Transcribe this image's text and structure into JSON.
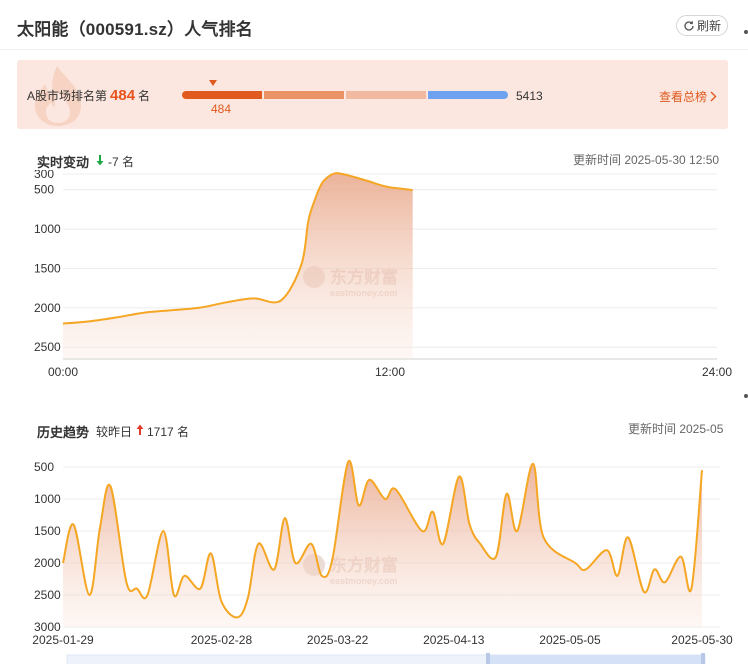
{
  "header": {
    "title": "太阳能（000591.sz）人气排名",
    "refresh_label": "刷新"
  },
  "rank": {
    "prefix": "A股市场排名第",
    "value": "484",
    "suffix": "名",
    "marker_label": "484",
    "total": "5413",
    "view_all": "查看总榜",
    "position_fraction": 0.0894
  },
  "realtime": {
    "title": "实时变动",
    "change_text": "-7 名",
    "update_time": "更新时间 2025-05-30 12:50"
  },
  "history": {
    "title": "历史趋势",
    "change_prefix": "较昨日",
    "change_text": "1717 名",
    "update_time": "更新时间 2025-05"
  },
  "watermark": {
    "cn": "东方财富",
    "en": "eastmoney.com"
  },
  "colors": {
    "line": "#f5a623",
    "accent": "#e0591e",
    "down": "#1ea844",
    "up": "#e03c2c"
  },
  "chart_data": [
    {
      "type": "area",
      "x_axis": "time",
      "xticks": [
        "00:00",
        "12:00",
        "24:00"
      ],
      "yticks": [
        300,
        500,
        1000,
        1500,
        2000,
        2500
      ],
      "ylim": [
        2650,
        300
      ],
      "y_inverted": true,
      "grid": true,
      "x": [
        "00:00",
        "01:00",
        "02:00",
        "03:00",
        "04:00",
        "05:00",
        "06:00",
        "07:00",
        "08:00",
        "08:45",
        "09:00",
        "09:15",
        "09:30",
        "09:45",
        "10:00",
        "10:15",
        "10:30",
        "10:45",
        "11:00",
        "11:15",
        "11:30",
        "11:45",
        "12:00",
        "12:30",
        "12:50"
      ],
      "values": [
        2200,
        2170,
        2120,
        2060,
        2030,
        2000,
        1930,
        1880,
        1905,
        1450,
        900,
        620,
        420,
        330,
        290,
        300,
        320,
        345,
        370,
        395,
        425,
        450,
        470,
        490,
        505
      ]
    },
    {
      "type": "area",
      "x_axis": "date",
      "xticks": [
        "2025-01-29",
        "2025-02-28",
        "2025-03-22",
        "2025-04-13",
        "2025-05-05",
        "2025-05-30"
      ],
      "yticks": [
        500,
        1000,
        1500,
        2000,
        2500,
        3000
      ],
      "ylim": [
        3000,
        500
      ],
      "y_inverted": true,
      "grid": true,
      "x": [
        "2025-01-29",
        "2025-01-31",
        "2025-02-03",
        "2025-02-05",
        "2025-02-07",
        "2025-02-10",
        "2025-02-12",
        "2025-02-14",
        "2025-02-17",
        "2025-02-19",
        "2025-02-21",
        "2025-02-24",
        "2025-02-26",
        "2025-02-28",
        "2025-03-03",
        "2025-03-05",
        "2025-03-07",
        "2025-03-10",
        "2025-03-12",
        "2025-03-14",
        "2025-03-17",
        "2025-03-19",
        "2025-03-21",
        "2025-03-24",
        "2025-03-26",
        "2025-03-28",
        "2025-03-31",
        "2025-04-02",
        "2025-04-07",
        "2025-04-09",
        "2025-04-11",
        "2025-04-14",
        "2025-04-16",
        "2025-04-18",
        "2025-04-21",
        "2025-04-23",
        "2025-04-25",
        "2025-04-28",
        "2025-04-30",
        "2025-05-06",
        "2025-05-08",
        "2025-05-12",
        "2025-05-14",
        "2025-05-16",
        "2025-05-19",
        "2025-05-21",
        "2025-05-23",
        "2025-05-26",
        "2025-05-28",
        "2025-05-30"
      ],
      "values": [
        2000,
        1400,
        2500,
        1450,
        800,
        2300,
        2400,
        2500,
        1500,
        2500,
        2200,
        2400,
        1850,
        2600,
        2850,
        2550,
        1700,
        2100,
        1300,
        2000,
        1700,
        2200,
        1950,
        420,
        1100,
        700,
        1000,
        850,
        1500,
        1200,
        1700,
        650,
        1400,
        1700,
        1900,
        920,
        1500,
        450,
        1600,
        2000,
        2100,
        1800,
        2200,
        1600,
        2450,
        2100,
        2300,
        1900,
        2400,
        550
      ]
    }
  ]
}
